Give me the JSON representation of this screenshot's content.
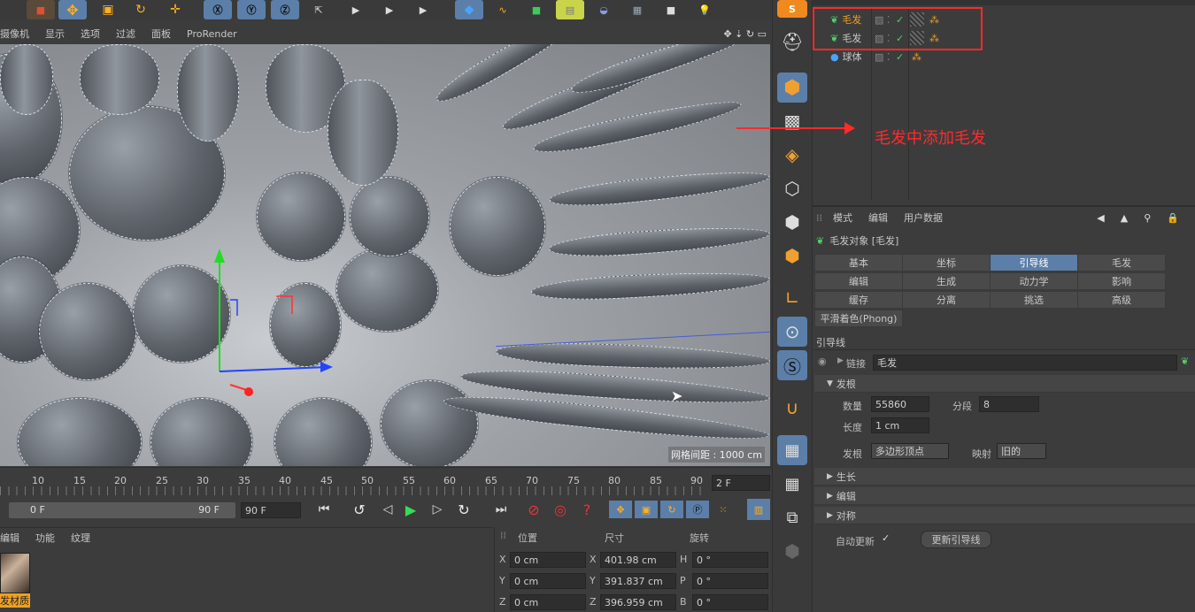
{
  "viewport_menu": [
    "摄像机",
    "显示",
    "选项",
    "过滤",
    "面板",
    "ProRender"
  ],
  "viewport_info": "网格间距 : 1000 cm",
  "annotation": "毛发中添加毛发",
  "object_manager": {
    "items": [
      {
        "name": "毛发",
        "icon": "hair-icon"
      },
      {
        "name": "毛发",
        "icon": "hair-icon"
      },
      {
        "name": "球体",
        "icon": "sphere-icon"
      }
    ]
  },
  "attributes": {
    "menu": [
      "模式",
      "编辑",
      "用户数据"
    ],
    "object_title": "毛发对象 [毛发]",
    "tabs_row1": [
      "基本",
      "坐标",
      "引导线",
      "毛发"
    ],
    "tabs_row2": [
      "编辑",
      "生成",
      "动力学",
      "影响"
    ],
    "tabs_row3": [
      "缓存",
      "分离",
      "挑选",
      "高级"
    ],
    "tab_extra": "平滑着色(Phong)",
    "active_tab": "引导线",
    "section_title": "引导线",
    "link_label": "链接",
    "link_value": "毛发",
    "root_section": "发根",
    "count_label": "数量",
    "count_value": "55860",
    "segments_label": "分段",
    "segments_value": "8",
    "length_label": "长度",
    "length_value": "1 cm",
    "root_label": "发根",
    "root_value": "多边形顶点",
    "mapping_label": "映射",
    "mapping_value": "旧的",
    "growth_section": "生长",
    "edit_section": "编辑",
    "symmetry_section": "对称",
    "auto_update_label": "自动更新",
    "update_button": "更新引导线"
  },
  "timeline": {
    "ticks": [
      "10",
      "15",
      "20",
      "25",
      "30",
      "35",
      "40",
      "45",
      "50",
      "55",
      "60",
      "65",
      "70",
      "75",
      "80",
      "85",
      "90"
    ],
    "current_frame": "2 F",
    "range_start": "0 F",
    "range_end": "90 F",
    "end_field": "90 F"
  },
  "material_panel": {
    "menu": [
      "编辑",
      "功能",
      "纹理"
    ],
    "material_name": "发材质"
  },
  "coords": {
    "headers": [
      "位置",
      "尺寸",
      "旋转"
    ],
    "rows": [
      {
        "axis": "X",
        "pos": "0 cm",
        "size_axis": "X",
        "size": "401.98 cm",
        "rot_axis": "H",
        "rot": "0 °"
      },
      {
        "axis": "Y",
        "pos": "0 cm",
        "size_axis": "Y",
        "size": "391.837 cm",
        "rot_axis": "P",
        "rot": "0 °"
      },
      {
        "axis": "Z",
        "pos": "0 cm",
        "size_axis": "Z",
        "size": "396.959 cm",
        "rot_axis": "B",
        "rot": "0 °"
      }
    ]
  },
  "colors": {
    "accent": "#ff2a2a",
    "active_tab": "#5b7fa8",
    "panel": "#3c3c3c"
  }
}
